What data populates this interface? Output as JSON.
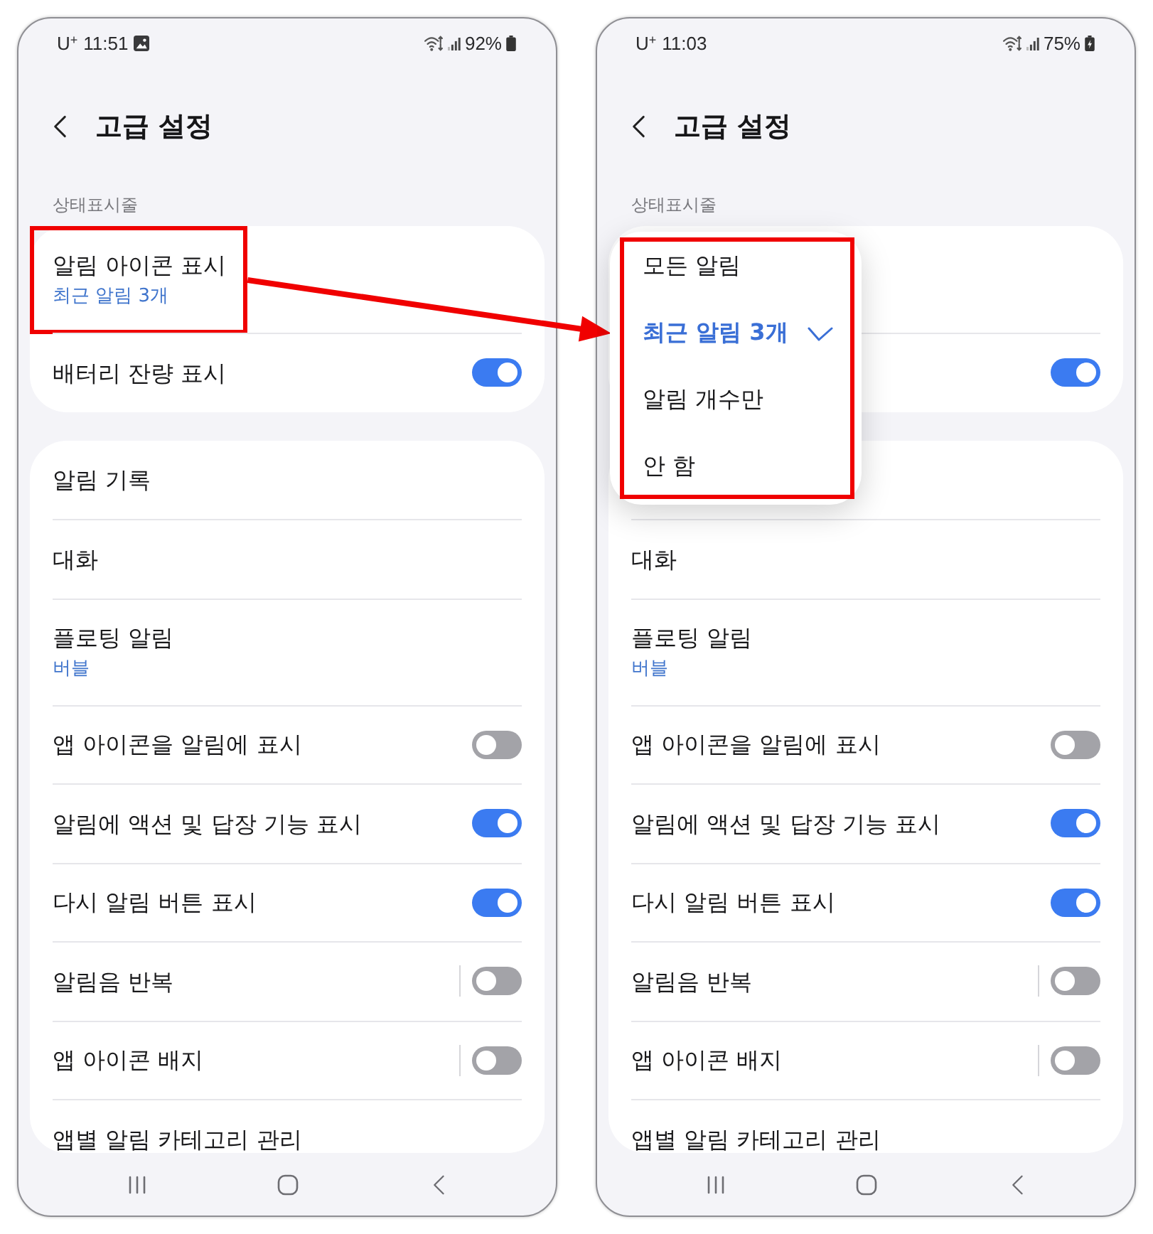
{
  "phones": [
    {
      "status_bar": {
        "carrier": "U$^{+}$",
        "time": "11:51",
        "notification_icons": [
          {
            "kind": "picture"
          }
        ],
        "battery": "92%",
        "charging": false
      },
      "header": {
        "title": "고급 설정"
      },
      "sections": [
        {
          "header": "상태표시줄",
          "rows": [
            {
              "kind": "nav",
              "title": "알림 아이콘 표시",
              "subtitle": "최근 알림 3개",
              "highlighted": true
            },
            {
              "kind": "toggle",
              "title": "배터리 잔량 표시",
              "on": true,
              "highlighted": false
            }
          ]
        },
        {
          "rows": [
            {
              "kind": "nav",
              "title": "알림 기록",
              "highlighted": false
            },
            {
              "kind": "nav",
              "title": "대화",
              "highlighted": false
            },
            {
              "kind": "nav",
              "title": "플로팅 알림",
              "subtitle": "버블",
              "highlighted": false
            },
            {
              "kind": "toggle",
              "title": "앱 아이콘을 알림에 표시",
              "on": false,
              "highlighted": false
            },
            {
              "kind": "toggle",
              "title": "알림에 액션 및 답장 기능 표시",
              "on": true,
              "highlighted": false
            },
            {
              "kind": "toggle",
              "title": "다시 알림 버튼 표시",
              "on": true,
              "highlighted": false
            },
            {
              "kind": "split",
              "title": "알림음 반복",
              "on": false,
              "highlighted": false
            },
            {
              "kind": "split",
              "title": "앱 아이콘 배지",
              "on": false,
              "highlighted": false
            },
            {
              "kind": "nav",
              "title": "앱별 알림 카테고리 관리",
              "highlighted": false
            }
          ]
        }
      ]
    },
    {
      "status_bar": {
        "carrier": "U$^{+}$",
        "time": "11:03",
        "battery": "75%",
        "charging": true
      },
      "header": {
        "title": "고급 설정"
      },
      "sections": [
        {
          "header": "상태표시줄",
          "rows": [
            {
              "kind": "blank",
              "tall": true,
              "highlighted": false
            },
            {
              "kind": "toggle",
              "on": true,
              "highlighted": false
            }
          ]
        },
        {
          "rows": [
            {
              "kind": "blank",
              "tall": false,
              "highlighted": false
            },
            {
              "kind": "nav",
              "title": "대화",
              "highlighted": false
            },
            {
              "kind": "nav",
              "title": "플로팅 알림",
              "subtitle": "버블",
              "highlighted": false
            },
            {
              "kind": "toggle",
              "title": "앱 아이콘을 알림에 표시",
              "on": false,
              "highlighted": false
            },
            {
              "kind": "toggle",
              "title": "알림에 액션 및 답장 기능 표시",
              "on": true,
              "highlighted": false
            },
            {
              "kind": "toggle",
              "title": "다시 알림 버튼 표시",
              "on": true,
              "highlighted": false
            },
            {
              "kind": "split",
              "title": "알림음 반복",
              "on": false,
              "highlighted": false
            },
            {
              "kind": "split",
              "title": "앱 아이콘 배지",
              "on": false,
              "highlighted": false
            },
            {
              "kind": "nav",
              "title": "앱별 알림 카테고리 관리",
              "highlighted": false
            }
          ]
        }
      ],
      "popup": {
        "highlighted": true,
        "options": [
          {
            "label": "모든 알림",
            "selected": false
          },
          {
            "label": "최근 알림 3개",
            "selected": true
          },
          {
            "label": "알림 개수만",
            "selected": false
          },
          {
            "label": "안 함",
            "selected": false
          }
        ]
      }
    }
  ],
  "callout_arrow": true
}
